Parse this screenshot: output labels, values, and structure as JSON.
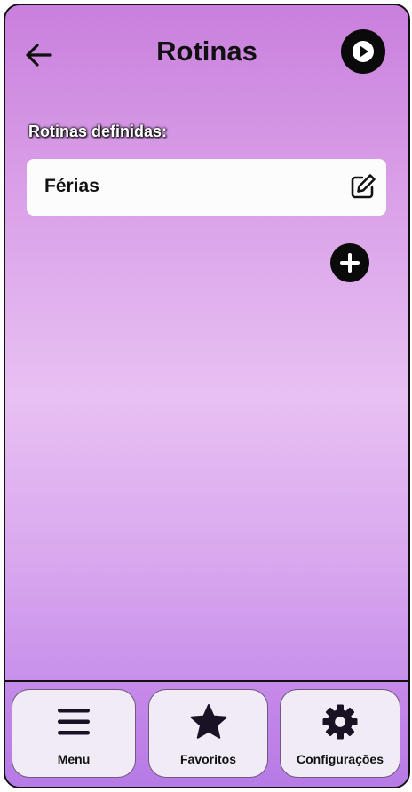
{
  "header": {
    "title": "Rotinas",
    "back_icon": "arrow-left-icon",
    "play_icon": "play-icon"
  },
  "routines": {
    "section_label": "Rotinas definidas:",
    "items": [
      {
        "name": "Férias",
        "edit_icon": "edit-icon"
      }
    ],
    "add_icon": "plus-icon"
  },
  "bottom_nav": {
    "items": [
      {
        "label": "Menu",
        "icon": "hamburger-menu-icon"
      },
      {
        "label": "Favoritos",
        "icon": "star-icon"
      },
      {
        "label": "Configurações",
        "icon": "gear-icon"
      }
    ]
  },
  "colors": {
    "gradient_top": "#c97fdd",
    "gradient_middle": "#e8c0f3",
    "gradient_bottom": "#b97ce8",
    "nav_button_bg": "#f1ebf6",
    "dark": "#0a0a0a"
  }
}
